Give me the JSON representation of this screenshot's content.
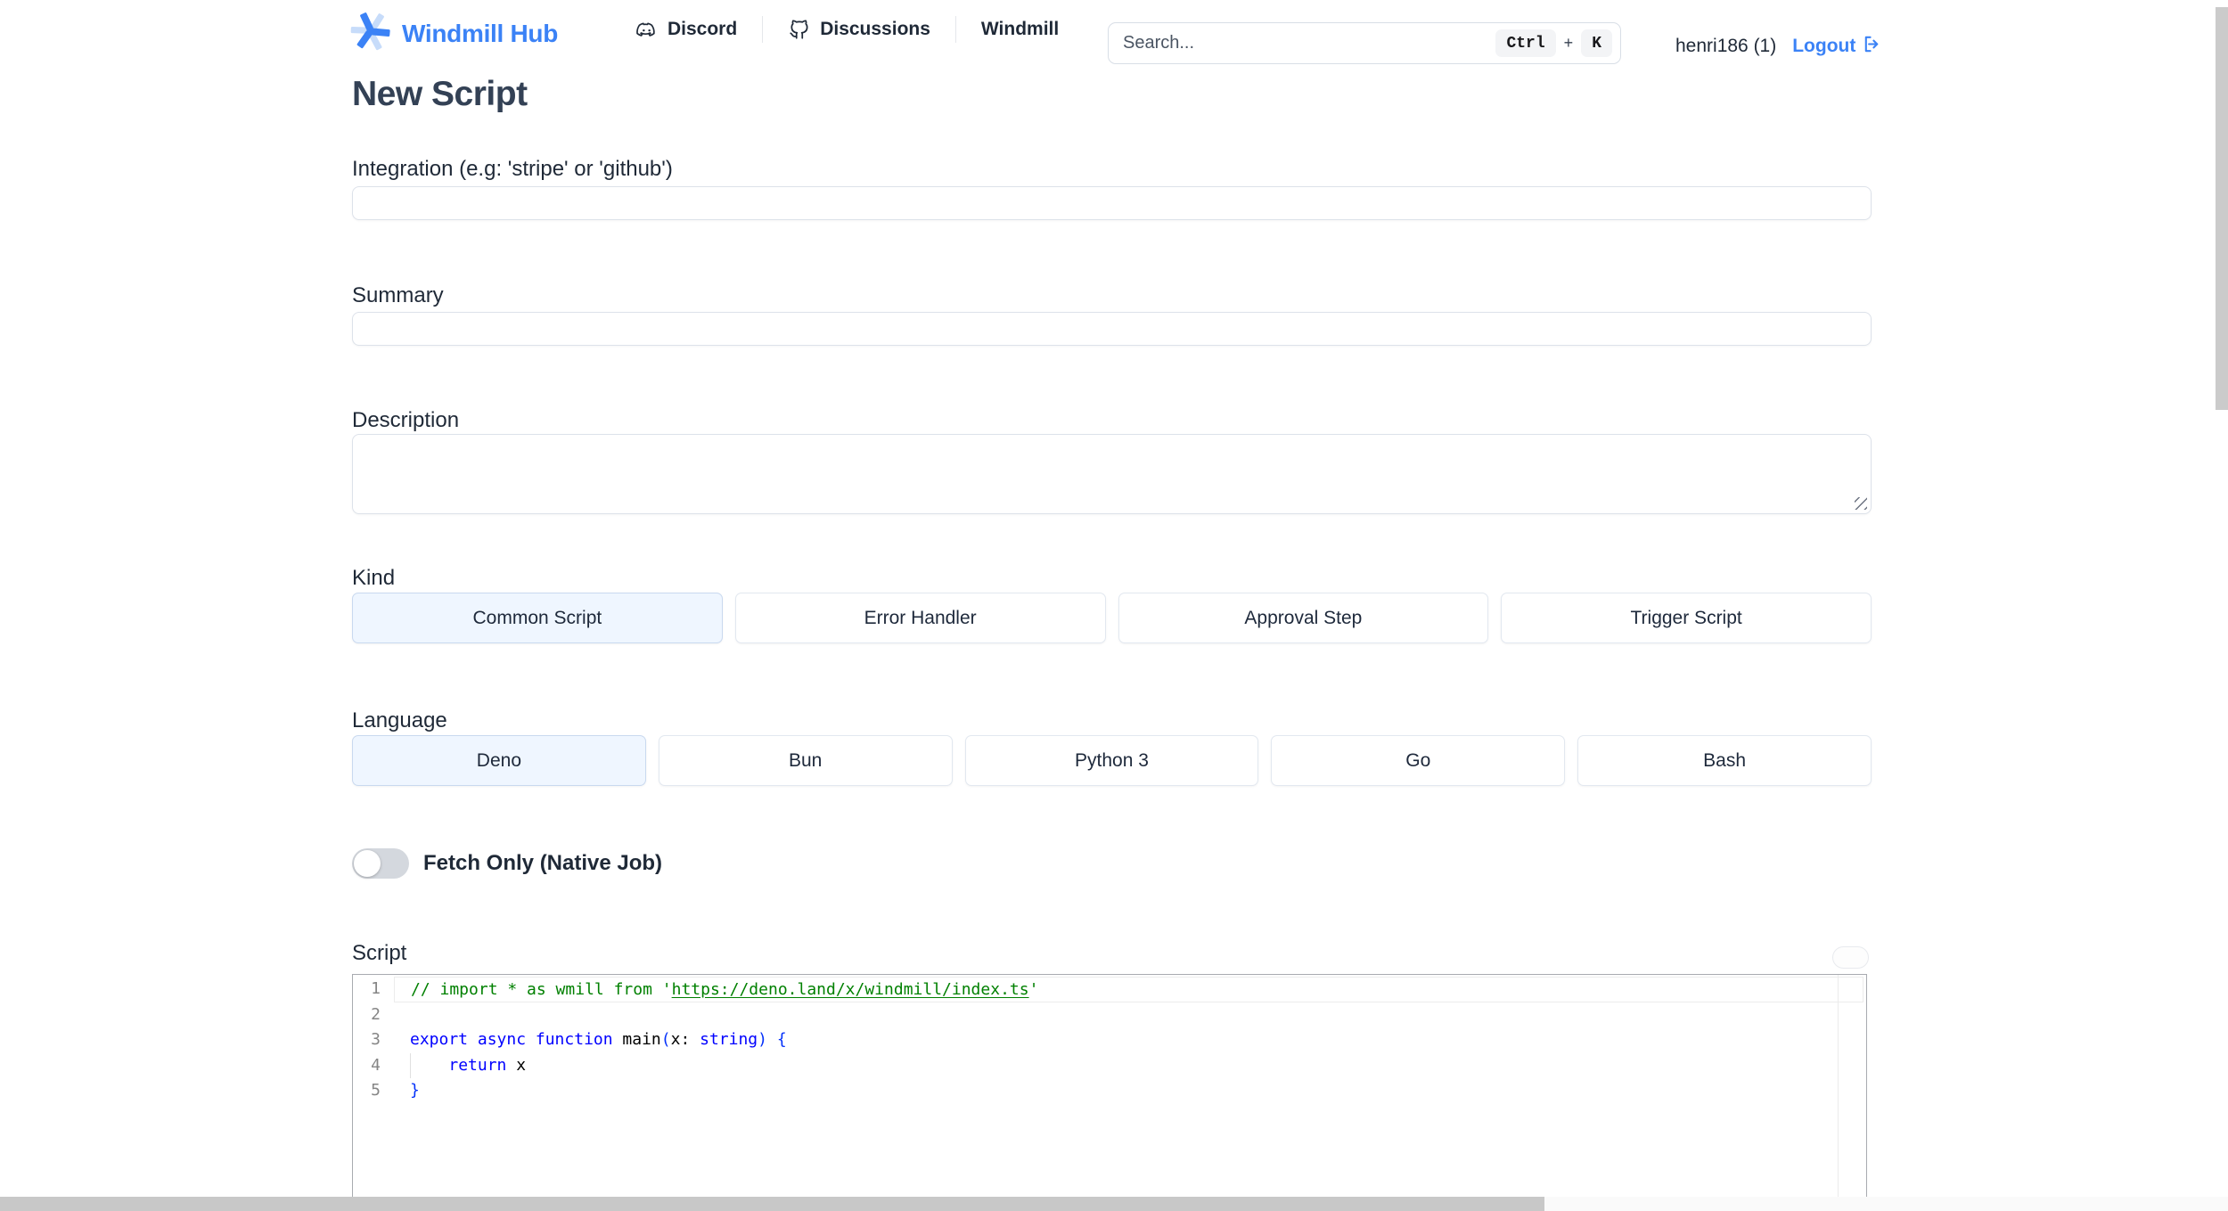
{
  "header": {
    "logo_text": "Windmill Hub",
    "nav": [
      {
        "label": "Discord",
        "icon": "discord-icon"
      },
      {
        "label": "Discussions",
        "icon": "github-icon"
      },
      {
        "label": "Windmill",
        "icon": null
      }
    ],
    "search": {
      "placeholder": "Search...",
      "shortcut_keys": [
        "Ctrl",
        "K"
      ],
      "shortcut_separator": "+"
    },
    "user": {
      "name": "henri186 (1)",
      "logout_label": "Logout"
    }
  },
  "page": {
    "title": "New Script"
  },
  "form": {
    "integration": {
      "label": "Integration (e.g: 'stripe' or 'github')",
      "value": ""
    },
    "summary": {
      "label": "Summary",
      "value": ""
    },
    "description": {
      "label": "Description",
      "value": ""
    },
    "kind": {
      "label": "Kind",
      "options": [
        "Common Script",
        "Error Handler",
        "Approval Step",
        "Trigger Script"
      ],
      "selected": "Common Script"
    },
    "language": {
      "label": "Language",
      "options": [
        "Deno",
        "Bun",
        "Python 3",
        "Go",
        "Bash"
      ],
      "selected": "Deno"
    },
    "fetch_only": {
      "label": "Fetch Only (Native Job)",
      "enabled": false
    },
    "script": {
      "label": "Script"
    }
  },
  "editor": {
    "lines": [
      {
        "num": "1",
        "current": true,
        "segments": [
          {
            "text": "// import * as wmill from '",
            "cls": "tok-comment"
          },
          {
            "text": "https://deno.land/x/windmill/index.ts",
            "cls": "tok-comment tok-link"
          },
          {
            "text": "'",
            "cls": "tok-comment"
          }
        ]
      },
      {
        "num": "2",
        "segments": []
      },
      {
        "num": "3",
        "segments": [
          {
            "text": "export async function",
            "cls": "tok-kw"
          },
          {
            "text": " main",
            "cls": "tok-plain"
          },
          {
            "text": "(",
            "cls": "tok-bracket"
          },
          {
            "text": "x: ",
            "cls": "tok-plain"
          },
          {
            "text": "string",
            "cls": "tok-kw"
          },
          {
            "text": ")",
            "cls": "tok-bracket"
          },
          {
            "text": " ",
            "cls": "tok-plain"
          },
          {
            "text": "{",
            "cls": "tok-bracket"
          }
        ]
      },
      {
        "num": "4",
        "guide": true,
        "segments": [
          {
            "text": "    ",
            "cls": "tok-plain"
          },
          {
            "text": "return",
            "cls": "tok-kw"
          },
          {
            "text": " x",
            "cls": "tok-plain"
          }
        ]
      },
      {
        "num": "5",
        "segments": [
          {
            "text": "}",
            "cls": "tok-bracket"
          }
        ]
      }
    ]
  },
  "colors": {
    "accent": "#3b82f6",
    "selected_option_bg": "#eff6ff",
    "comment_green": "#008000",
    "keyword_blue": "#0000ff",
    "bracket_blue": "#0431fa"
  }
}
